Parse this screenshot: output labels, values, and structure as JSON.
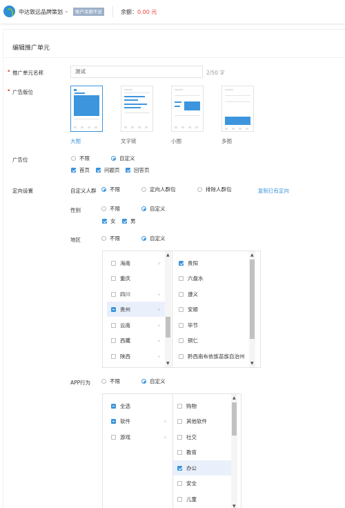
{
  "header": {
    "account": "中达致远品牌策划",
    "badge": "账户余额不足",
    "balance_label": "余额：",
    "balance_value": "0.00 元",
    "colors": {
      "brand": "#2e8fd8",
      "danger": "#f04134"
    }
  },
  "page": {
    "title": "编辑推广单元"
  },
  "form": {
    "name": {
      "label": "推广单元名称",
      "value": "测试",
      "count": "2/50 字"
    },
    "slot": {
      "label": "广告版位",
      "options": [
        "大图",
        "文字链",
        "小图",
        "多图"
      ],
      "selected": "大图"
    },
    "position": {
      "label": "广告位",
      "unlimited": "不限",
      "custom": "自定义",
      "checks": [
        "首页",
        "问题页",
        "回答页"
      ]
    },
    "targeting": {
      "label": "定向设置",
      "crowd": {
        "label": "自定义人群",
        "opts": [
          "不限",
          "定向人群包",
          "排除人群包"
        ],
        "copy": "复制已有定向"
      },
      "gender": {
        "label": "性别",
        "unlimited": "不限",
        "custom": "自定义",
        "checks": [
          "女",
          "男"
        ]
      },
      "region": {
        "label": "地区",
        "unlimited": "不限",
        "custom": "自定义",
        "provinces": [
          "海南",
          "重庆",
          "四川",
          "贵州",
          "云南",
          "西藏",
          "陕西"
        ],
        "cities": [
          "贵阳",
          "六盘水",
          "遵义",
          "安顺",
          "毕节",
          "铜仁",
          "黔西南布依族苗族自治州"
        ]
      },
      "app": {
        "label": "APP行为",
        "unlimited": "不限",
        "custom": "自定义",
        "cats": [
          "全选",
          "软件",
          "游戏"
        ],
        "subs": [
          "购物",
          "其他软件",
          "社交",
          "教育",
          "办公",
          "安全",
          "儿童"
        ]
      }
    }
  }
}
